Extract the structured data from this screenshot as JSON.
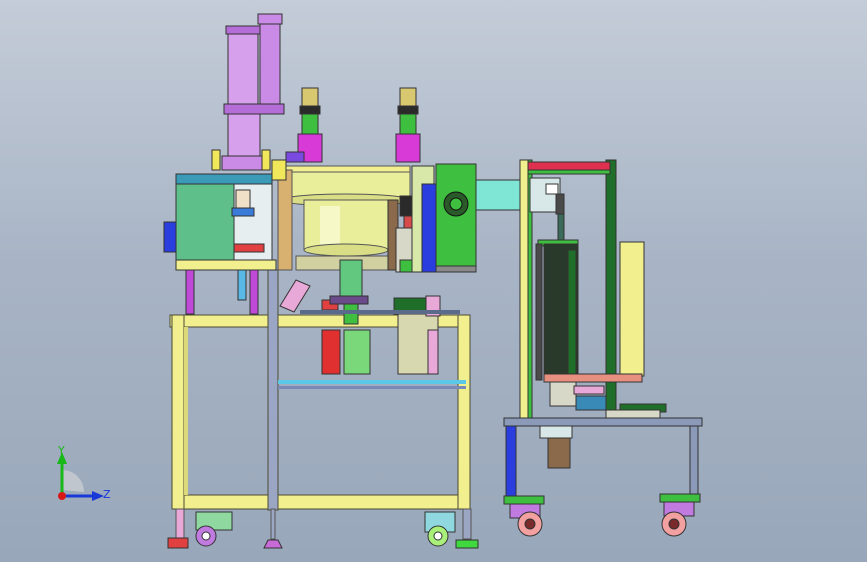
{
  "viewport": {
    "background_top": "#c4ccd8",
    "background_bottom": "#98a7ba"
  },
  "axes_triad": {
    "y_label": "Y",
    "z_label": "Z",
    "y_color": "#18b818",
    "z_color": "#1838d8",
    "origin_color": "#d81818"
  },
  "machine_colors": {
    "frame": "#f2ef8e",
    "frame_edge": "#5a5a3a",
    "post": "#8a9ab8",
    "cylinder": "#c98be6",
    "press_box": "#5fbf8a",
    "bowl": "#e9ee9a",
    "green_panel": "#3fbf3f",
    "blue_panel": "#2a3ee0",
    "teal_arm": "#7fe6d6",
    "caster_red": "#f2a0a0",
    "caster_green": "#7fe67f",
    "caster_purple": "#c07ae0",
    "magenta": "#d83ad8",
    "dark_green": "#1f6f2a",
    "red": "#e03030"
  }
}
